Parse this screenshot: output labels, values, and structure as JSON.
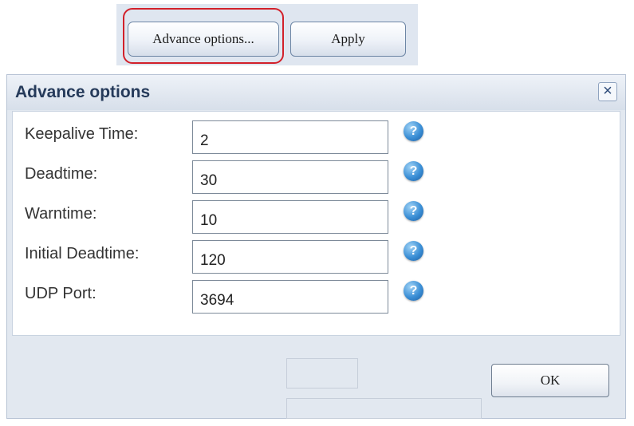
{
  "toolbar": {
    "advance_options_button": "Advance options...",
    "apply_button": "Apply"
  },
  "dialog": {
    "title": "Advance options",
    "close_glyph": "×",
    "fields": [
      {
        "label": "Keepalive Time:",
        "value": "2"
      },
      {
        "label": "Deadtime:",
        "value": "30"
      },
      {
        "label": "Warntime:",
        "value": "10"
      },
      {
        "label": "Initial Deadtime:",
        "value": "120"
      },
      {
        "label": "UDP Port:",
        "value": "3694"
      }
    ],
    "help_glyph": "?",
    "ok_button": "OK"
  },
  "colors": {
    "highlight_border": "#d2202a",
    "title_text": "#253a5a",
    "help_icon": "#3b8fd6",
    "dialog_background": "#e2e8f0"
  },
  "icons": {
    "close": "close-icon",
    "help": "help-icon"
  }
}
